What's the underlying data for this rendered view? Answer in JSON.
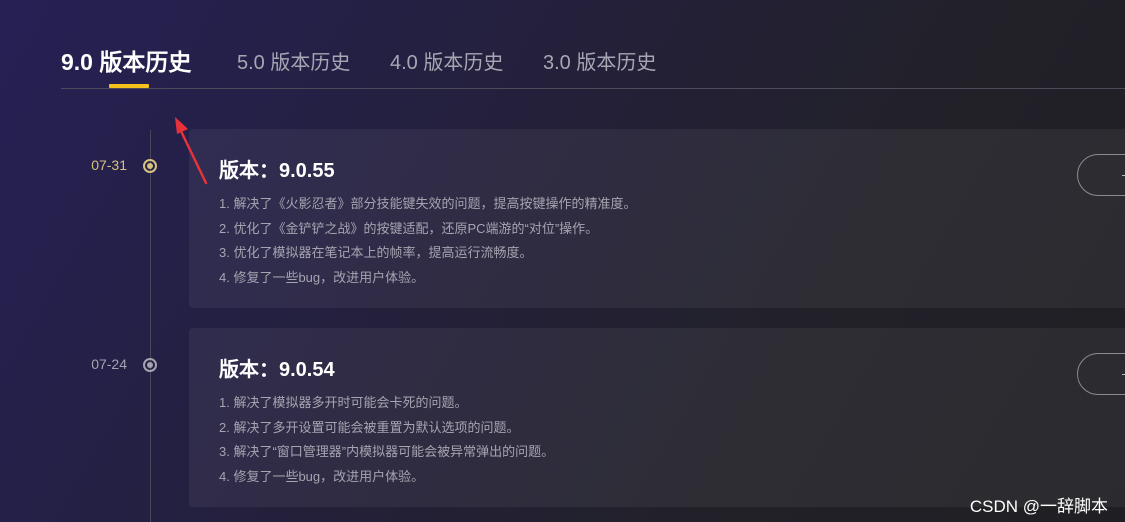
{
  "tabs": [
    {
      "label": "9.0 版本历史",
      "active": true
    },
    {
      "label": "5.0 版本历史",
      "active": false
    },
    {
      "label": "4.0 版本历史",
      "active": false
    },
    {
      "label": "3.0 版本历史",
      "active": false
    }
  ],
  "colors": {
    "accent_underline": "#f4c21a",
    "active_date": "#d8c17f",
    "inactive_date": "#a4a3ad",
    "annotation_arrow": "#e8323a"
  },
  "releases": [
    {
      "date": "07-31",
      "title": "版本：9.0.55",
      "notes": [
        "1. 解决了《火影忍者》部分技能键失效的问题，提高按键操作的精准度。",
        "2. 优化了《金铲铲之战》的按键适配，还原PC端游的“对位”操作。",
        "3. 优化了模拟器在笔记本上的帧率，提高运行流畅度。",
        "4. 修复了一些bug，改进用户体验。"
      ]
    },
    {
      "date": "07-24",
      "title": "版本：9.0.54",
      "notes": [
        "1. 解决了模拟器多开时可能会卡死的问题。",
        "2. 解决了多开设置可能会被重置为默认选项的问题。",
        "3. 解决了“窗口管理器”内模拟器可能会被异常弹出的问题。",
        "4. 修复了一些bug，改进用户体验。"
      ]
    }
  ],
  "watermark": "CSDN @一辞脚本"
}
